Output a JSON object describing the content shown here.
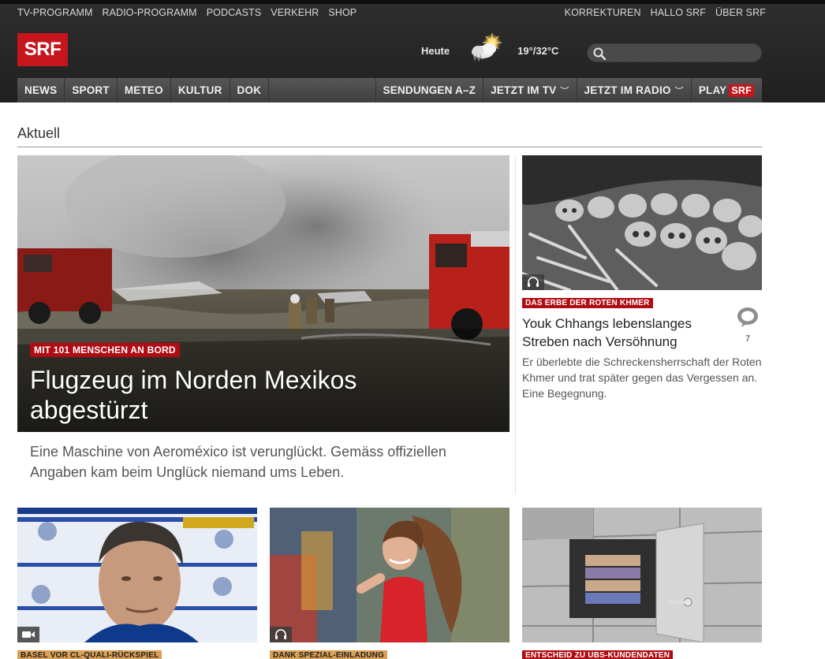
{
  "header": {
    "left_links": [
      "TV-PROGRAMM",
      "RADIO-PROGRAMM",
      "PODCASTS",
      "VERKEHR",
      "SHOP"
    ],
    "right_links": [
      "KORREKTUREN",
      "HALLO SRF",
      "ÜBER SRF"
    ],
    "logo": "SRF",
    "weather": {
      "day": "Heute",
      "temperature": "19°/32°C",
      "icon": "sun-cloud-icon"
    },
    "search": {
      "placeholder": "",
      "icon": "search-icon"
    }
  },
  "nav": {
    "left": [
      "NEWS",
      "SPORT",
      "METEO",
      "KULTUR",
      "DOK"
    ],
    "sendungen": "SENDUNGEN A–Z",
    "jetzt_tv": "JETZT IM TV",
    "jetzt_radio": "JETZT IM RADIO",
    "play": "PLAY",
    "play_badge": "SRF"
  },
  "section": {
    "title": "Aktuell"
  },
  "lead": {
    "kicker": "MIT 101 MENSCHEN AN BORD",
    "title": "Flugzeug im Norden Mexikos abgestürzt",
    "teaser": "Eine Maschine von Aeroméxico ist verunglückt. Gemäss offiziellen Angaben kam beim Unglück niemand ums Leben."
  },
  "side": {
    "kicker": "DAS ERBE DER ROTEN KHMER",
    "title": "Youk Chhangs lebenslanges Streben nach Versöhnung",
    "teaser": "Er überlebte die Schreckensherrschaft der Roten Khmer und trat später gegen das Vergessen an. Eine Begegnung.",
    "comments": "7",
    "media": "headphones-icon"
  },
  "cards": [
    {
      "kicker": "BASEL VOR CL-QUALI-RÜCKSPIEL",
      "media": "video-icon"
    },
    {
      "kicker": "DANK SPEZIAL-EINLADUNG",
      "media": "headphones-icon"
    },
    {
      "kicker": "ENTSCHEID ZU UBS-KUNDENDATEN"
    }
  ],
  "colors": {
    "brand_red": "#c6151d",
    "kicker_red": "#af0c14",
    "kicker_orange": "#d9a056",
    "header_dark": "#2a2a2a"
  }
}
